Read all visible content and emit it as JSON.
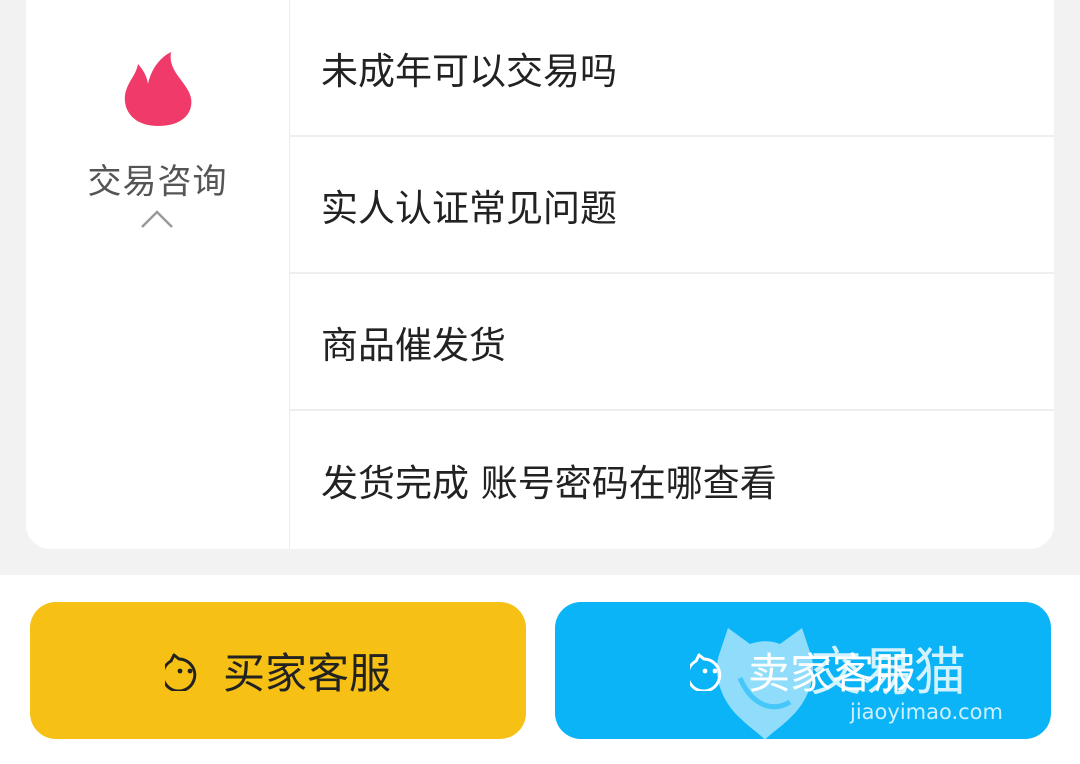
{
  "category": {
    "label": "交易咨询",
    "icon": "flame-icon",
    "icon_color": "#ef3a6a",
    "expand_icon": "chevron-up-icon"
  },
  "faq": [
    {
      "label": "未成年可以交易吗"
    },
    {
      "label": "实人认证常见问题"
    },
    {
      "label": "商品催发货"
    },
    {
      "label": "发货完成 账号密码在哪查看"
    }
  ],
  "buttons": {
    "buyer_service": {
      "label": "买家客服",
      "color": "#f6c114",
      "icon": "cat-face-icon"
    },
    "seller_service": {
      "label": "卖家客服",
      "color": "#0ab4f7",
      "icon": "cat-face-icon"
    }
  },
  "watermark": {
    "brand": "交易猫",
    "url": "jiaoyimao.com"
  }
}
